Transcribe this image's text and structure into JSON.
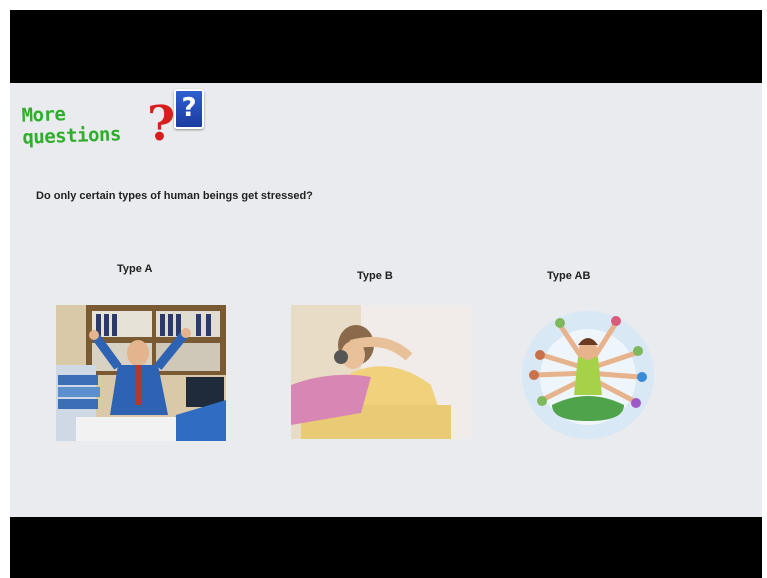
{
  "slide": {
    "title_line1": "More",
    "title_line2": "questions",
    "question_mark": "?",
    "question_box_mark": "?",
    "question": "Do only certain types of human beings get stressed?"
  },
  "types": [
    {
      "label": "Type A"
    },
    {
      "label": "Type B"
    },
    {
      "label": "Type AB"
    }
  ]
}
